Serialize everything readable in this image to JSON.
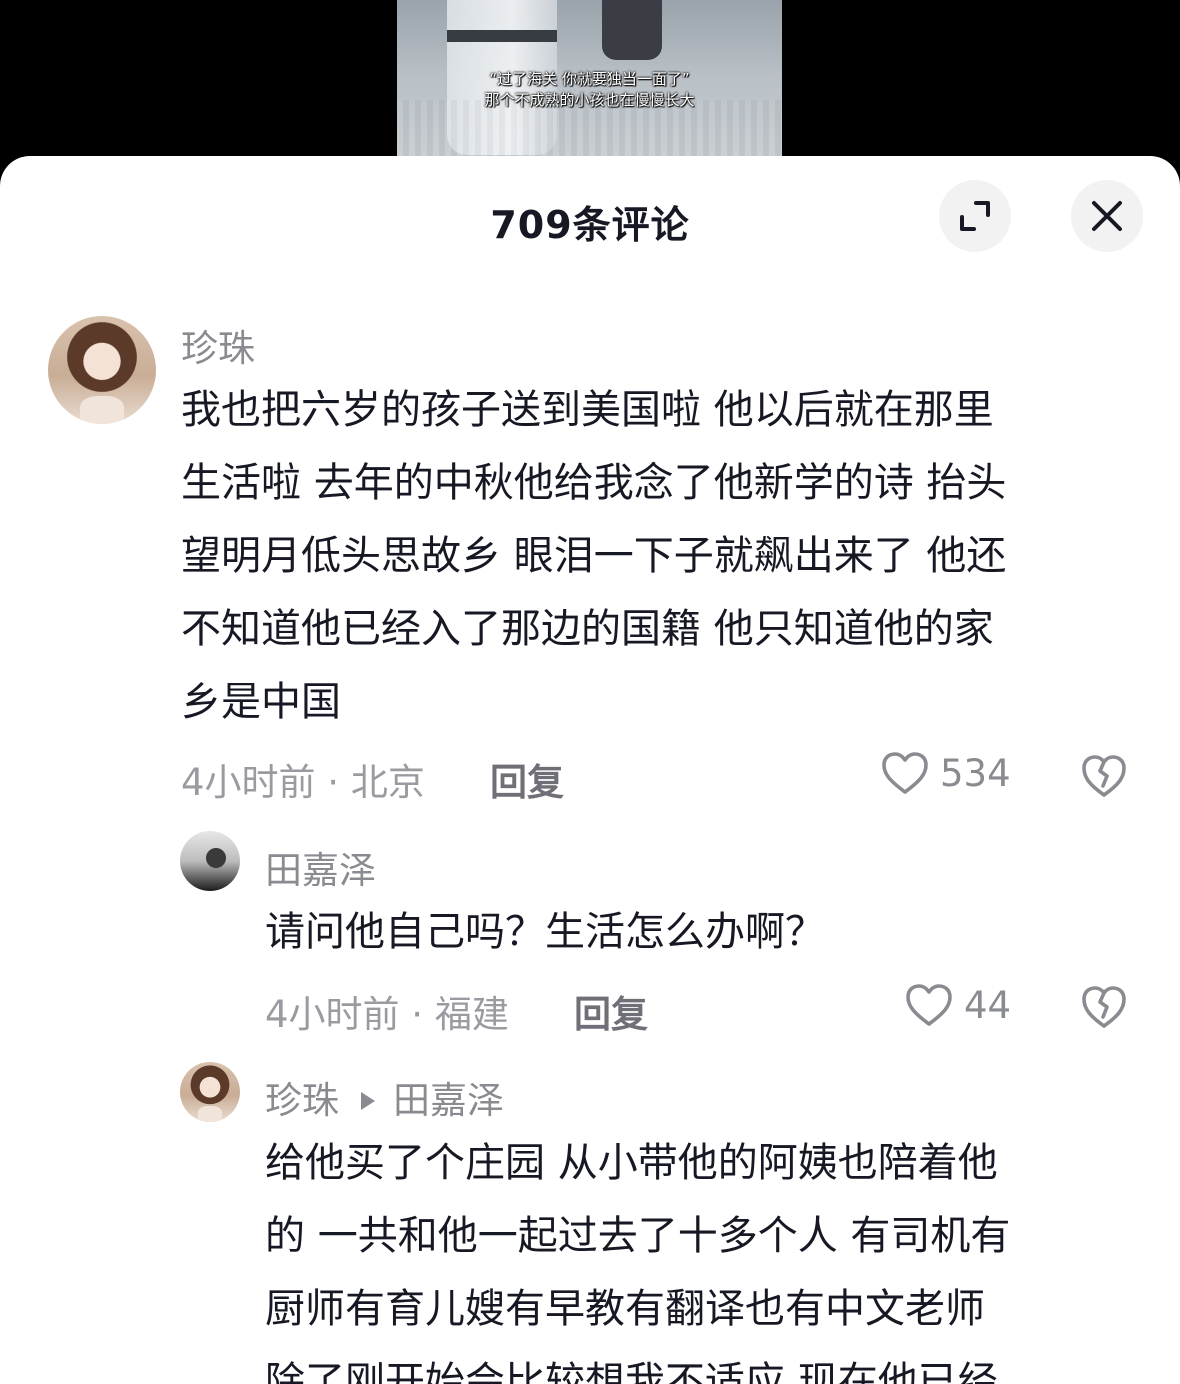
{
  "video": {
    "caption_line1": "“过了海关 你就要独当一面了”",
    "caption_line2": "那个不成熟的小孩也在慢慢长大"
  },
  "sheet": {
    "title": "709条评论",
    "expand_icon": "expand-icon",
    "close_icon": "close-icon"
  },
  "comments": [
    {
      "name": "珍珠",
      "lines": [
        "我也把六岁的孩子送到美国啦 他以后就在那里",
        "生活啦 去年的中秋他给我念了他新学的诗 抬头",
        "望明月低头思故乡 眼泪一下子就飙出来了 他还",
        "不知道他已经入了那边的国籍 他只知道他的家",
        "乡是中国"
      ],
      "meta": "4小时前 · 北京",
      "reply_label": "回复",
      "likes": "534"
    },
    {
      "name": "田嘉泽",
      "lines": [
        "请问他自己吗？生活怎么办啊？"
      ],
      "meta": "4小时前 · 福建",
      "reply_label": "回复",
      "likes": "44"
    },
    {
      "name": "珍珠",
      "reply_to": "田嘉泽",
      "lines": [
        "给他买了个庄园 从小带他的阿姨也陪着他",
        "的 一共和他一起过去了十多个人 有司机有",
        "厨师有育儿嫂有早教有翻译也有中文老师",
        "除了刚开始会比较想我不适应 现在他已经"
      ]
    }
  ]
}
